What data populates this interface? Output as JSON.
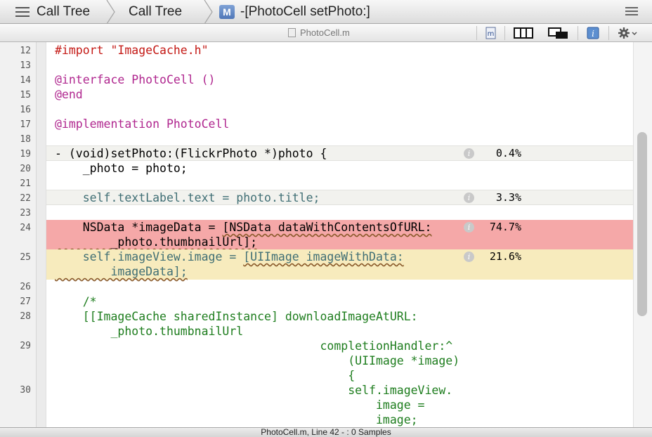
{
  "jumpbar": {
    "crumbs": [
      "Call Tree",
      "Call Tree",
      "-[PhotoCell setPhoto:]"
    ],
    "method_badge": "M"
  },
  "subbar": {
    "file_name": "PhotoCell.m",
    "file_icon_letter": "m"
  },
  "code_lines": [
    {
      "num": "12",
      "text": "#import \"ImageCache.h\""
    },
    {
      "num": "13",
      "text": ""
    },
    {
      "num": "14",
      "text": "@interface PhotoCell ()"
    },
    {
      "num": "15",
      "text": "@end"
    },
    {
      "num": "16",
      "text": ""
    },
    {
      "num": "17",
      "text": "@implementation PhotoCell"
    },
    {
      "num": "18",
      "text": ""
    },
    {
      "num": "19",
      "text": "- (void)setPhoto:(FlickrPhoto *)photo {",
      "percent": "0.4%"
    },
    {
      "num": "20",
      "text": "    _photo = photo;"
    },
    {
      "num": "21",
      "text": ""
    },
    {
      "num": "22",
      "text": "    self.textLabel.text = photo.title;",
      "percent": "3.3%"
    },
    {
      "num": "23",
      "text": ""
    },
    {
      "num": "24",
      "text_a": "    NSData *imageData = ",
      "text_b": "[NSData dataWithContentsOfURL:",
      "text_c": "        _photo.thumbnailUrl];",
      "percent": "74.7%"
    },
    {
      "num": "25",
      "text_a": "    self.imageView.image = ",
      "text_b": "[UIImage imageWithData:",
      "text_c": "        imageData];",
      "percent": "21.6%"
    },
    {
      "num": "26",
      "text": ""
    },
    {
      "num": "27",
      "text": "    /*"
    },
    {
      "num": "28",
      "text_a": "    [[ImageCache sharedInstance] downloadImageAtURL:",
      "text_c": "        _photo.thumbnailUrl"
    },
    {
      "num": "29",
      "text_a": "                                      completionHandler:^",
      "text_b": "                                          (UIImage *image)",
      "text_c": "                                          {"
    },
    {
      "num": "30",
      "text_a": "                                          self.imageView.",
      "text_b": "                                              image =",
      "text_c": "                                              image;"
    }
  ],
  "info_glyph": "i",
  "statusbar": {
    "text": "PhotoCell.m, Line 42 - : 0 Samples"
  },
  "colors": {
    "hot_line": "#f5a8a8",
    "warm_line": "#f7ebbd",
    "keyword": "#b0278f",
    "string": "#c41a16",
    "comment": "#1e7d1e"
  }
}
